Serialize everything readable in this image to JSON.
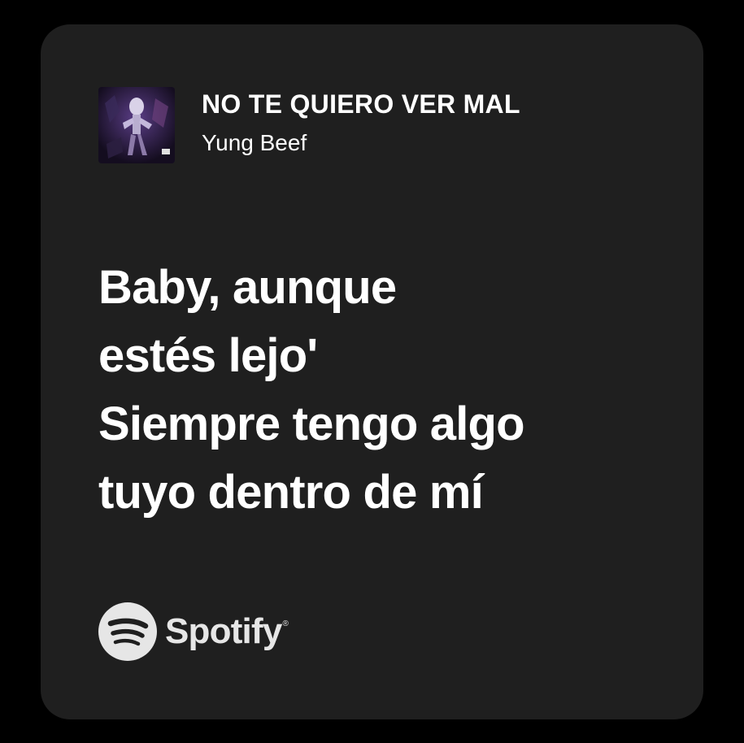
{
  "track": {
    "title": "NO TE QUIERO VER MAL",
    "artist": "Yung Beef",
    "cover_icon": "album-cover-art"
  },
  "lyrics": {
    "lines": [
      "Baby, aunque",
      "estés lejo'",
      "Siempre tengo algo",
      "tuyo dentro de mí"
    ]
  },
  "brand": {
    "name": "Spotify",
    "registered_mark": "®",
    "icon": "spotify-logo-icon"
  },
  "colors": {
    "page_background": "#000000",
    "card_background": "#1f1f1f",
    "text": "#ffffff",
    "logo": "#e6e6e6"
  }
}
